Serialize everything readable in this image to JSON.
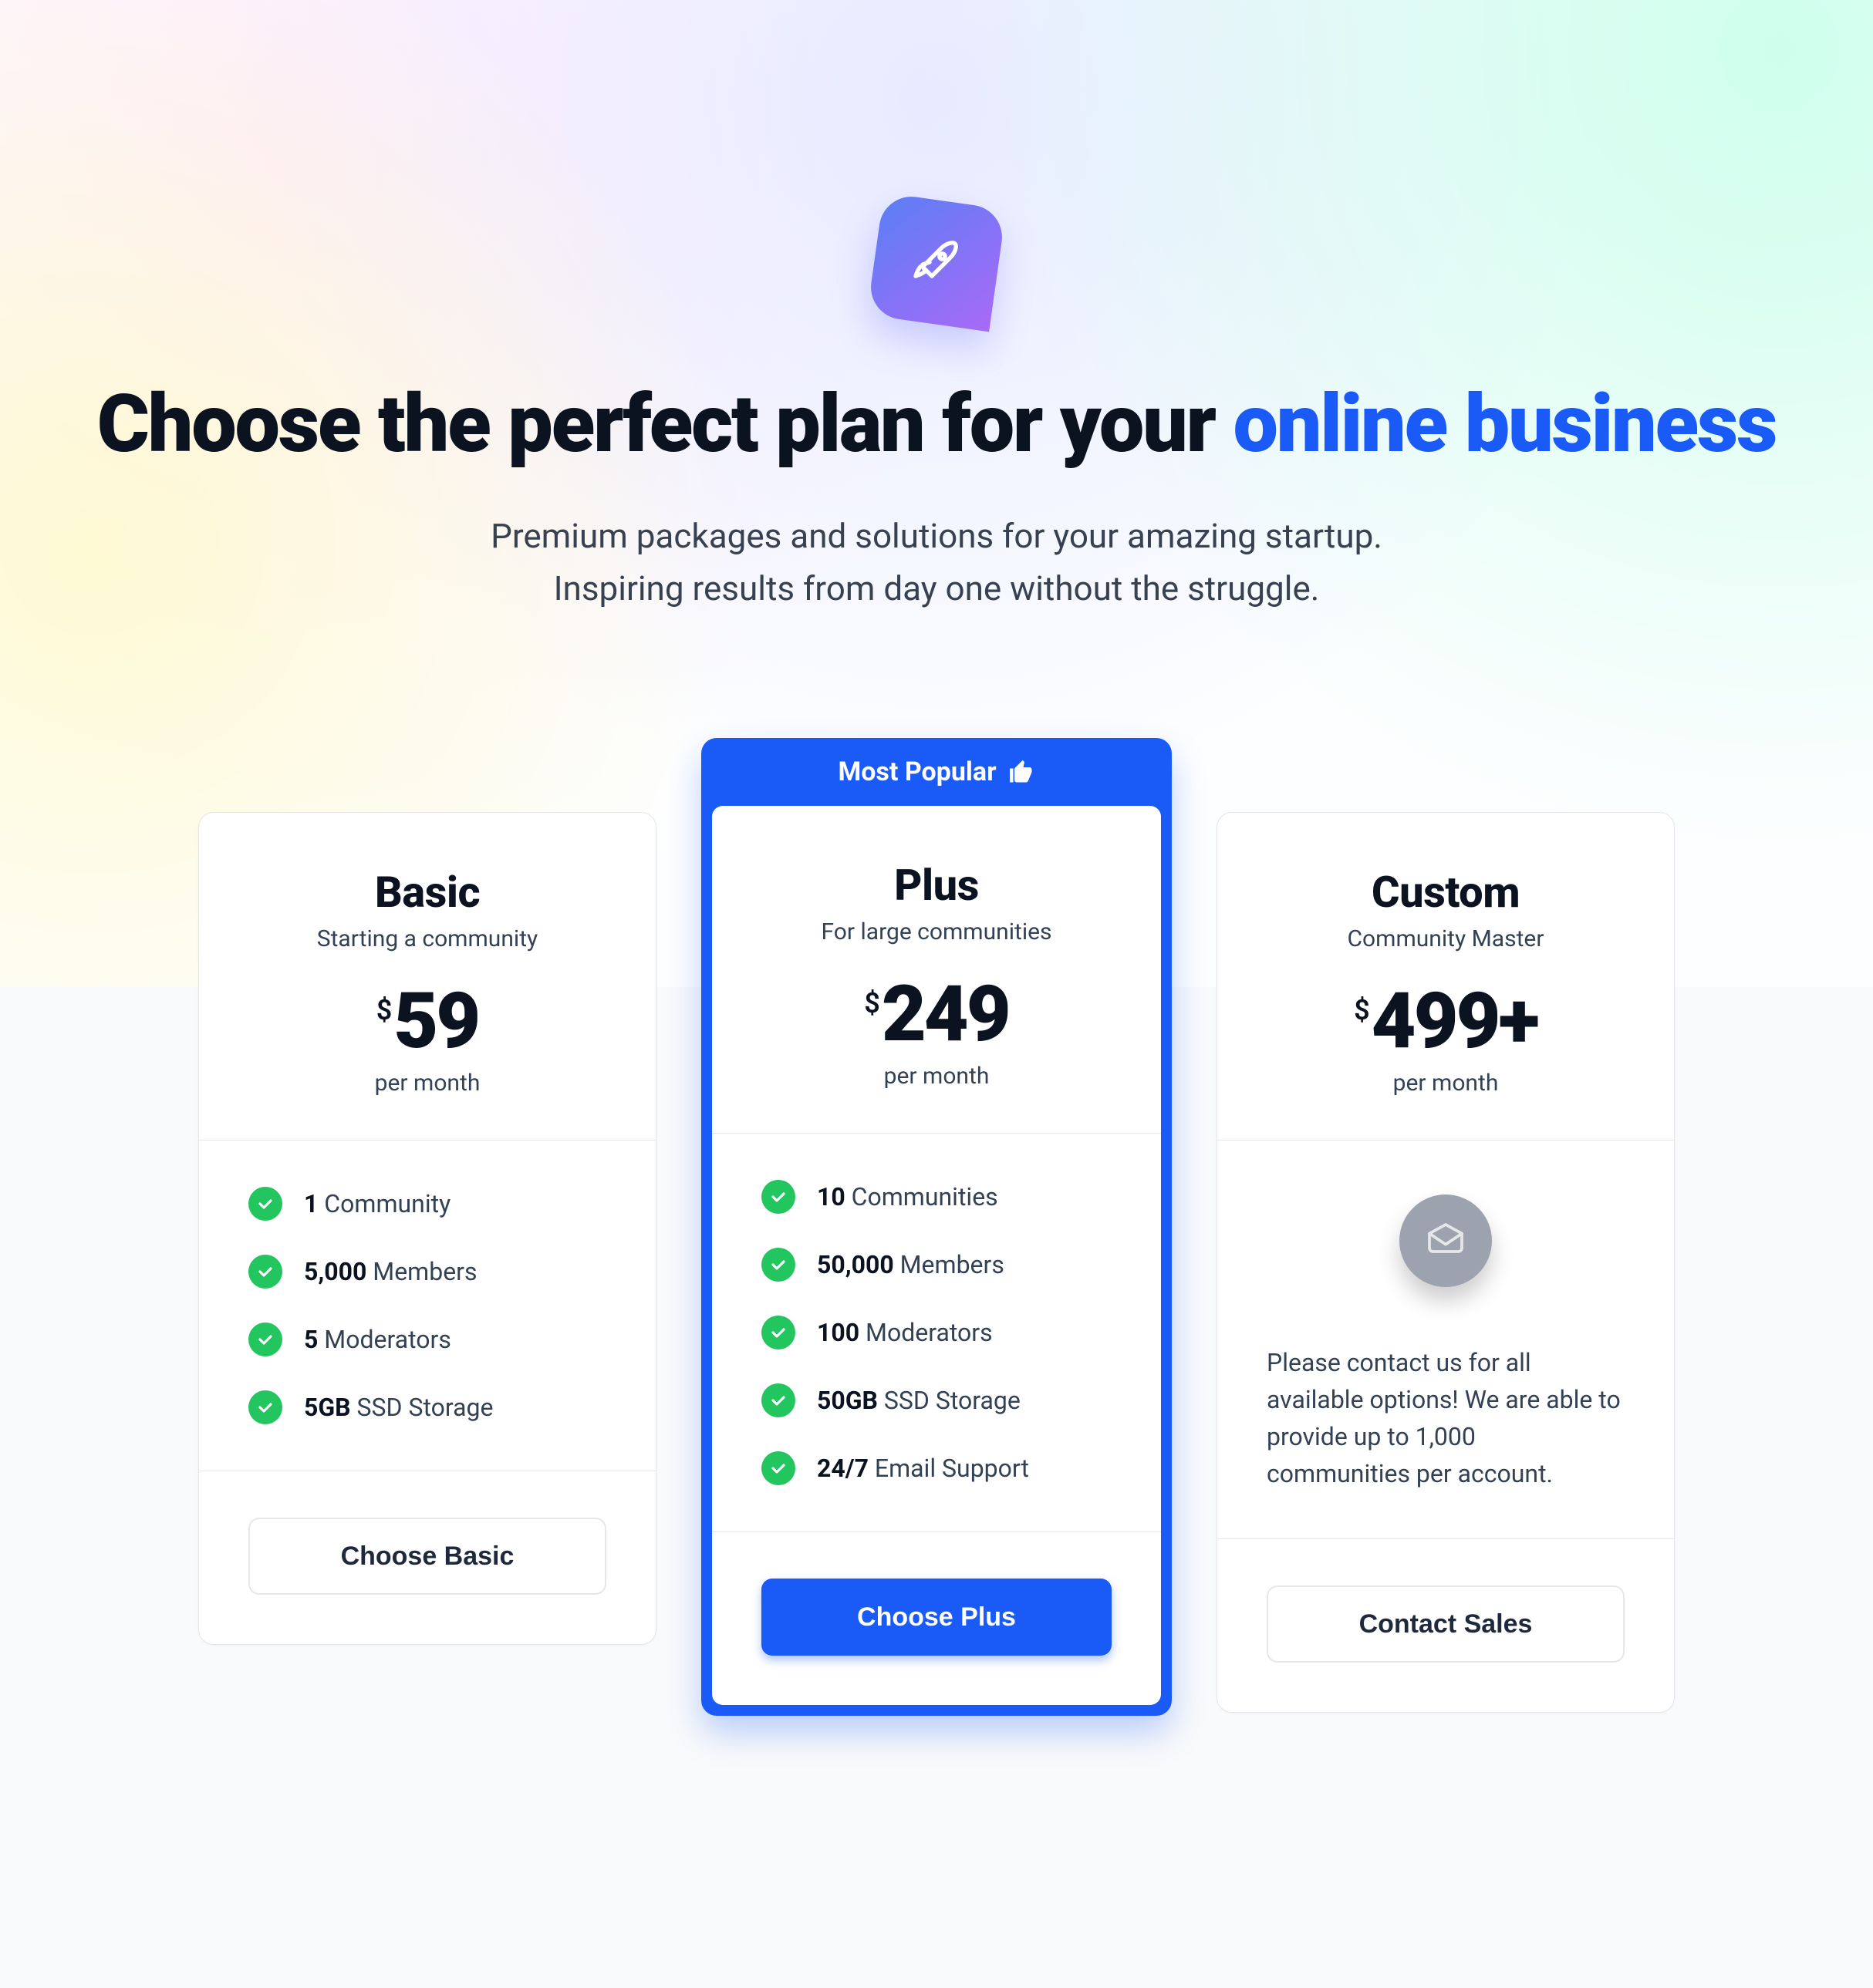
{
  "hero": {
    "title_prefix": "Choose the perfect plan for your ",
    "title_accent": "online business",
    "subtitle_line1": "Premium packages and solutions for your amazing startup.",
    "subtitle_line2": "Inspiring results from day one without the struggle."
  },
  "featured_label": "Most Popular",
  "plans": {
    "basic": {
      "name": "Basic",
      "tag": "Starting a community",
      "currency": "$",
      "amount": "59",
      "period": "per month",
      "cta": "Choose Basic",
      "features": [
        {
          "bold": "1",
          "rest": " Community"
        },
        {
          "bold": "5,000",
          "rest": " Members"
        },
        {
          "bold": "5",
          "rest": " Moderators"
        },
        {
          "bold": "5GB",
          "rest": " SSD Storage"
        }
      ]
    },
    "plus": {
      "name": "Plus",
      "tag": "For large communities",
      "currency": "$",
      "amount": "249",
      "period": "per month",
      "cta": "Choose Plus",
      "features": [
        {
          "bold": "10",
          "rest": " Communities"
        },
        {
          "bold": "50,000",
          "rest": " Members"
        },
        {
          "bold": "100",
          "rest": " Moderators"
        },
        {
          "bold": "50GB",
          "rest": " SSD Storage"
        },
        {
          "bold": "24/7",
          "rest": " Email Support"
        }
      ]
    },
    "custom": {
      "name": "Custom",
      "tag": "Community Master",
      "currency": "$",
      "amount": "499+",
      "period": "per month",
      "cta": "Contact Sales",
      "description": "Please contact us for all available options! We are able to provide up to 1,000 communities per account."
    }
  }
}
